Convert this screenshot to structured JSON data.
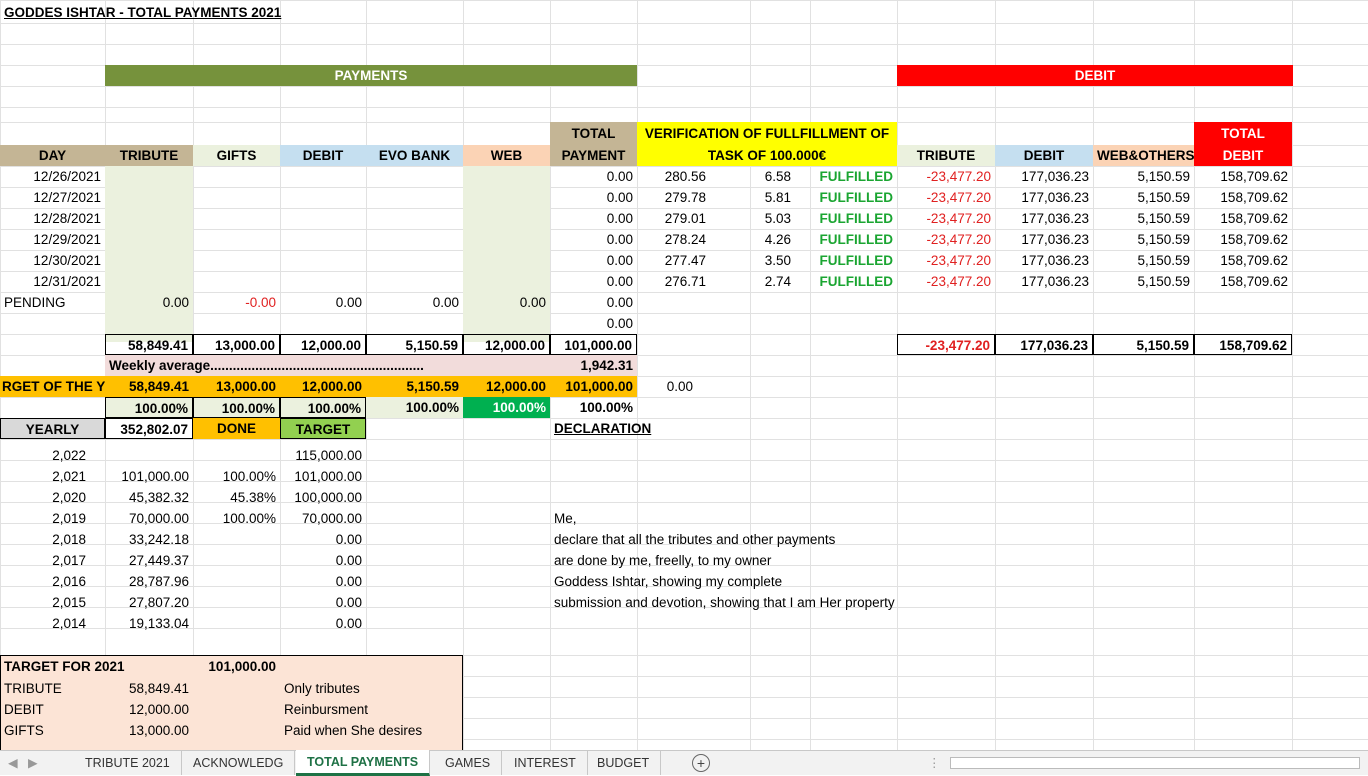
{
  "title": "GODDES ISHTAR - TOTAL PAYMENTS 2021",
  "banners": {
    "payments": "PAYMENTS",
    "debit": "DEBIT"
  },
  "headers": {
    "day": "DAY",
    "tribute": "TRIBUTE",
    "gifts": "GIFTS",
    "debit": "DEBIT",
    "evo_bank": "EVO BANK",
    "web": "WEB",
    "total_payment_1": "TOTAL",
    "total_payment_2": "PAYMENT",
    "verification_1": "VERIFICATION OF FULLFILLMENT OF",
    "verification_2": "TASK OF 100.000€",
    "d_tribute": "TRIBUTE",
    "d_debit": "DEBIT",
    "d_web_others": "WEB&OTHERS",
    "total_debit_1": "TOTAL",
    "total_debit_2": "DEBIT"
  },
  "rows": [
    {
      "day": "12/26/2021",
      "total": "0.00",
      "v1": "280.56",
      "v2": "6.58",
      "status": "FULFILLED",
      "d_tribute": "-23,477.20",
      "d_debit": "177,036.23",
      "d_web": "5,150.59",
      "d_total": "158,709.62"
    },
    {
      "day": "12/27/2021",
      "total": "0.00",
      "v1": "279.78",
      "v2": "5.81",
      "status": "FULFILLED",
      "d_tribute": "-23,477.20",
      "d_debit": "177,036.23",
      "d_web": "5,150.59",
      "d_total": "158,709.62"
    },
    {
      "day": "12/28/2021",
      "total": "0.00",
      "v1": "279.01",
      "v2": "5.03",
      "status": "FULFILLED",
      "d_tribute": "-23,477.20",
      "d_debit": "177,036.23",
      "d_web": "5,150.59",
      "d_total": "158,709.62"
    },
    {
      "day": "12/29/2021",
      "total": "0.00",
      "v1": "278.24",
      "v2": "4.26",
      "status": "FULFILLED",
      "d_tribute": "-23,477.20",
      "d_debit": "177,036.23",
      "d_web": "5,150.59",
      "d_total": "158,709.62"
    },
    {
      "day": "12/30/2021",
      "total": "0.00",
      "v1": "277.47",
      "v2": "3.50",
      "status": "FULFILLED",
      "d_tribute": "-23,477.20",
      "d_debit": "177,036.23",
      "d_web": "5,150.59",
      "d_total": "158,709.62"
    },
    {
      "day": "12/31/2021",
      "total": "0.00",
      "v1": "276.71",
      "v2": "2.74",
      "status": "FULFILLED",
      "d_tribute": "-23,477.20",
      "d_debit": "177,036.23",
      "d_web": "5,150.59",
      "d_total": "158,709.62"
    }
  ],
  "pending": {
    "label": "PENDING",
    "tribute": "0.00",
    "gifts": "-0.00",
    "debit": "0.00",
    "evo": "0.00",
    "web": "0.00",
    "total": "0.00",
    "extra": "0.00"
  },
  "totals": {
    "tribute": "58,849.41",
    "gifts": "13,000.00",
    "debit": "12,000.00",
    "evo": "5,150.59",
    "web": "12,000.00",
    "total": "101,000.00",
    "d_tribute": "-23,477.20",
    "d_debit": "177,036.23",
    "d_web": "5,150.59",
    "d_total": "158,709.62"
  },
  "weekly": {
    "label": "Weekly average.........................................................",
    "value": "1,942.31"
  },
  "target_year": {
    "label": "RGET OF THE YE",
    "tribute": "58,849.41",
    "gifts": "13,000.00",
    "debit": "12,000.00",
    "evo": "5,150.59",
    "web": "12,000.00",
    "total": "101,000.00",
    "extra": "0.00"
  },
  "percents": {
    "tribute": "100.00%",
    "gifts": "100.00%",
    "debit": "100.00%",
    "evo": "100.00%",
    "web": "100.00%",
    "total": "100.00%"
  },
  "yearly_header": {
    "label": "YEARLY",
    "value": "352,802.07",
    "done": "DONE",
    "target": "TARGET",
    "declaration": "DECLARATION"
  },
  "yearly": [
    {
      "year": "2,022",
      "amount": "",
      "pct": "",
      "target": "115,000.00"
    },
    {
      "year": "2,021",
      "amount": "101,000.00",
      "pct": "100.00%",
      "target": "101,000.00"
    },
    {
      "year": "2,020",
      "amount": "45,382.32",
      "pct": "45.38%",
      "target": "100,000.00"
    },
    {
      "year": "2,019",
      "amount": "70,000.00",
      "pct": "100.00%",
      "target": "70,000.00"
    },
    {
      "year": "2,018",
      "amount": "33,242.18",
      "pct": "",
      "target": "0.00"
    },
    {
      "year": "2,017",
      "amount": "27,449.37",
      "pct": "",
      "target": "0.00"
    },
    {
      "year": "2,016",
      "amount": "28,787.96",
      "pct": "",
      "target": "0.00"
    },
    {
      "year": "2,015",
      "amount": "27,807.20",
      "pct": "",
      "target": "0.00"
    },
    {
      "year": "2,014",
      "amount": "19,133.04",
      "pct": "",
      "target": "0.00"
    }
  ],
  "declaration_lines": [
    "Me,",
    "declare that all the tributes and other payments",
    "are done by me, freelly, to my owner",
    "Goddess Ishtar, showing my complete",
    "submission and devotion, showing that I am Her property"
  ],
  "target_box": {
    "title": "TARGET FOR 2021",
    "total": "101,000.00",
    "rows": [
      {
        "label": "TRIBUTE",
        "value": "58,849.41",
        "note": "Only tributes"
      },
      {
        "label": "DEBIT",
        "value": "12,000.00",
        "note": "Reinbursment"
      },
      {
        "label": "GIFTS",
        "value": "13,000.00",
        "note": "Paid when She desires"
      }
    ]
  },
  "tabs": [
    "TRIBUTE 2021",
    "ACKNOWLEDG",
    "TOTAL PAYMENTS",
    "GAMES",
    "INTEREST",
    "BUDGET"
  ],
  "active_tab": "TOTAL PAYMENTS",
  "colors": {
    "green_banner": "#76923c",
    "red_banner": "#ff0000",
    "tan": "#c4b595",
    "light_blue": "#c5dff0",
    "peach": "#fbd3b5",
    "yellow": "#ffff00",
    "orange": "#ffc000",
    "light_green": "#ebf1de",
    "pink": "#f2dcdb",
    "salmon": "#fce4d6",
    "bright_green": "#00b050",
    "excel_green": "#1e7145"
  }
}
